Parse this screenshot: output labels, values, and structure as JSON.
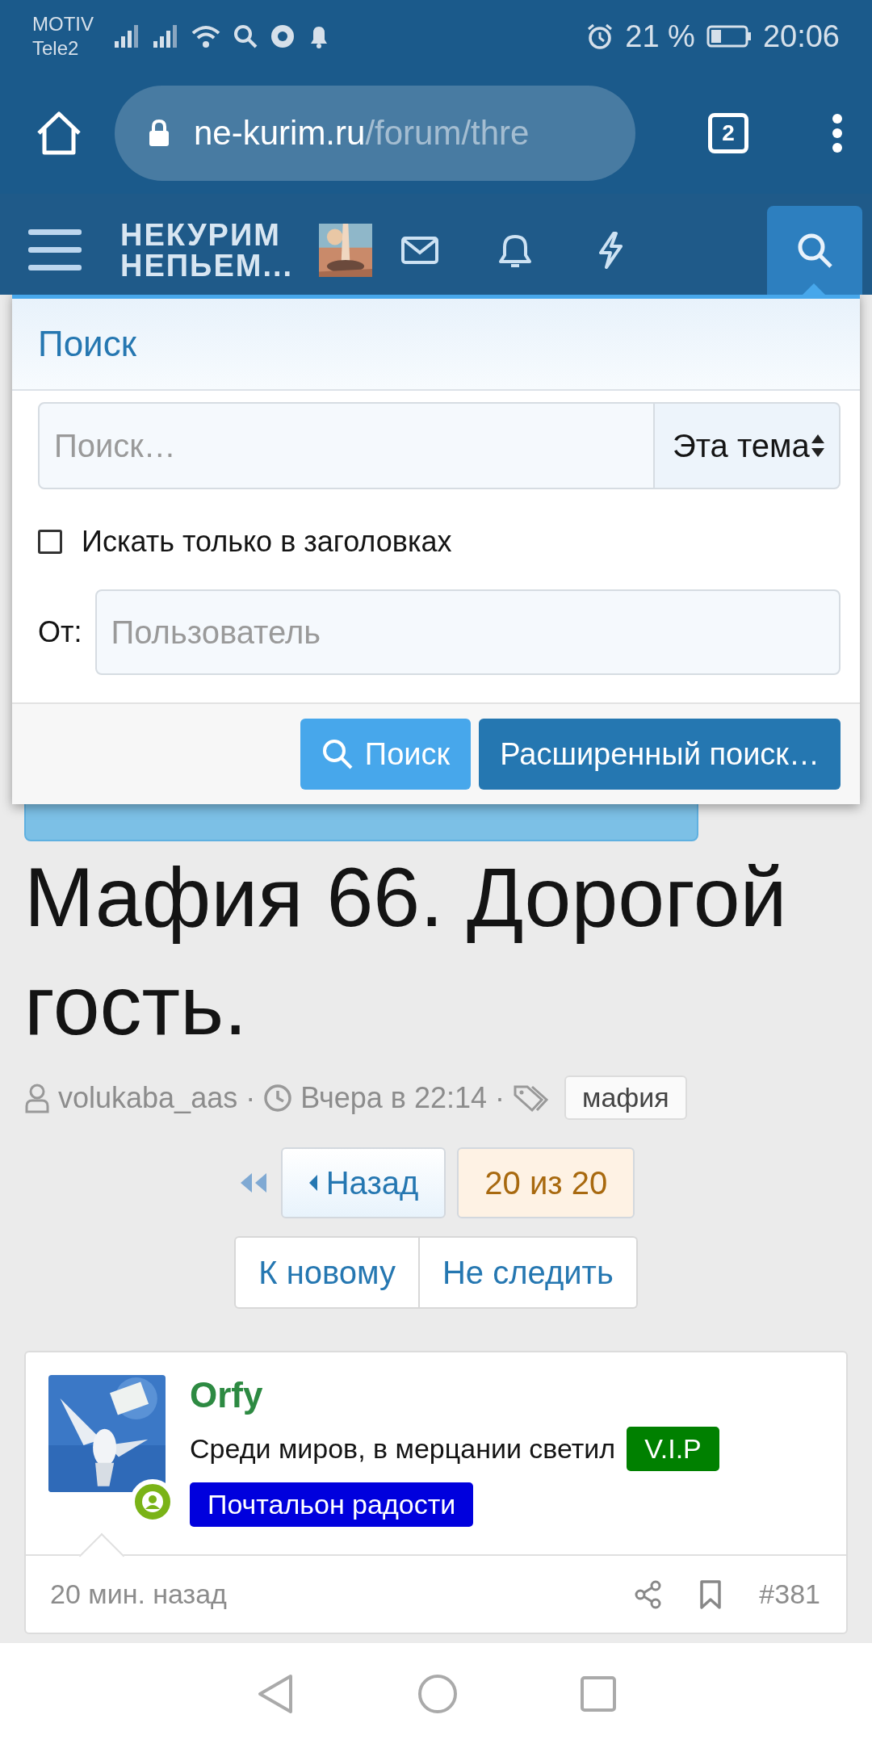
{
  "status_bar": {
    "carrier": "MOTIV",
    "carrier_2": "Tele2",
    "battery": "21 %",
    "time": "20:06"
  },
  "browser": {
    "url_host": "ne-kurim.ru",
    "url_path": "/forum/thre",
    "tab_count": "2"
  },
  "forum_header": {
    "logo_line_1": "НЕКУРИМ",
    "logo_line_2": "НЕПЬЕМ...",
    "search_selected": true
  },
  "search_menu": {
    "title": "Поиск",
    "query": {
      "placeholder": "Поиск…"
    },
    "scope": "Эта тема",
    "titles_only": {
      "label": "Искать только в заголовках",
      "checked": false
    },
    "from_label": "От:",
    "user": {
      "placeholder": "Пользователь"
    },
    "buttons": [
      {
        "label": "Поиск",
        "kind": "primary"
      },
      {
        "label": "Расширенный поиск…",
        "kind": "secondary"
      }
    ]
  },
  "thread": {
    "title": "Мафия 66. Дорогой гость.",
    "author": "volukaba_aas",
    "separators": [
      "·",
      "·"
    ],
    "date": "Вчера в 22:14",
    "tags": [
      "мафия"
    ]
  },
  "pagination": {
    "back": "Назад",
    "current": "20 из 20"
  },
  "thread_actions": [
    "К новому",
    "Не следить"
  ],
  "post": {
    "author": "Orfy",
    "online": true,
    "user_title": "Среди миров, в мерцании светил",
    "banners": [
      {
        "label": "V.I.P",
        "color": "#008000"
      },
      {
        "label": "Почтальон радости",
        "color": "#0000dd"
      }
    ],
    "time": "20 мин. назад",
    "number": "#381"
  }
}
